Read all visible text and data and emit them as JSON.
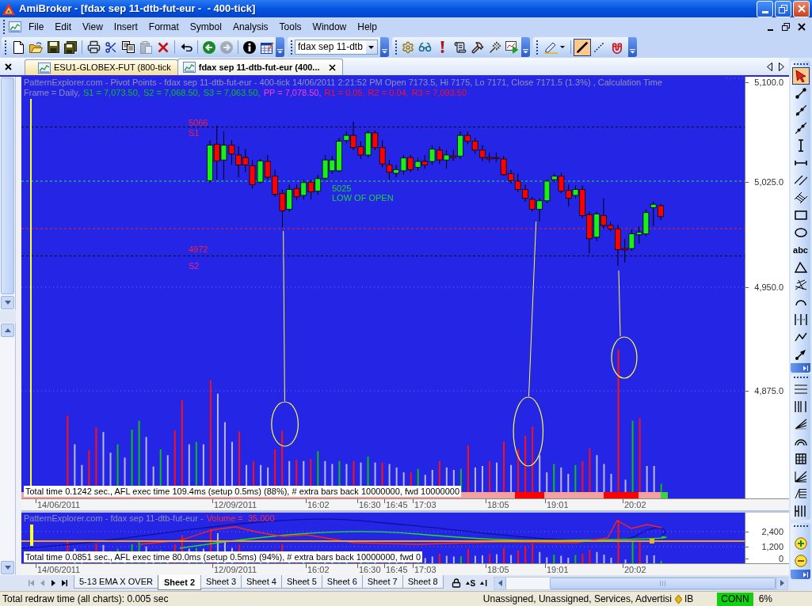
{
  "window": {
    "title": "AmiBroker - [fdax sep 11-dtb-fut-eur -  - 400-tick]"
  },
  "menu": [
    "File",
    "Edit",
    "View",
    "Insert",
    "Format",
    "Symbol",
    "Analysis",
    "Tools",
    "Window",
    "Help"
  ],
  "toolbar": {
    "standard": [
      {
        "kind": "new",
        "disabled": false
      },
      {
        "kind": "open",
        "disabled": false
      },
      {
        "kind": "save",
        "disabled": false
      },
      {
        "kind": "save_all",
        "disabled": false
      },
      {
        "kind": "print",
        "disabled": false
      },
      {
        "kind": "cut",
        "disabled": false
      },
      {
        "kind": "copy",
        "disabled": false
      },
      {
        "kind": "paste",
        "disabled": true
      },
      {
        "kind": "delete",
        "disabled": false
      },
      {
        "kind": "undo",
        "disabled": false
      },
      {
        "kind": "back",
        "disabled": false
      },
      {
        "kind": "forward",
        "disabled": true
      },
      {
        "kind": "info",
        "disabled": false
      },
      {
        "kind": "edit",
        "disabled": false
      }
    ],
    "symbol": {
      "value": "fdax sep 11-dtb"
    },
    "drawing": [
      {
        "kind": "pen",
        "selected": false
      },
      {
        "kind": "line",
        "selected": true
      },
      {
        "kind": "dotted",
        "selected": false
      },
      {
        "kind": "magnet",
        "selected": false
      }
    ]
  },
  "document_tabs": [
    {
      "label": "ESU1-GLOBEX-FUT (800-tick",
      "selected": false
    },
    {
      "label": "fdax sep 11-dtb-fut-eur (400...",
      "selected": true
    }
  ],
  "price_pane": {
    "title": "PatternExplorer.com - Pivot Points - fdax sep 11-dtb-fut-eur - 400-tick 14/06/2011 2:21:52 PM Open 7173.5, Hi 7175, Lo 7171, Close 7171.5 (1.3%) , Calculation Time",
    "pivots": [
      {
        "text": "Frame = Daily,",
        "color": "#9090b8"
      },
      {
        "text": "S1 = 7,073.50,",
        "color": "#10c020"
      },
      {
        "text": "S2 = 7,068.50,",
        "color": "#10c020"
      },
      {
        "text": "S3 = 7,063.50,",
        "color": "#10c020"
      },
      {
        "text": "PP = 7,078.50,",
        "color": "#ff40d0"
      },
      {
        "text": "R1 = 0.05,",
        "color": "#ff1020"
      },
      {
        "text": "R2 = 0.04,",
        "color": "#ff1020"
      },
      {
        "text": "R3 = 7,093.50",
        "color": "#ff1020"
      }
    ],
    "levels": [
      {
        "text": "5066",
        "color": "#ff2030"
      },
      {
        "text": "S1",
        "color": "#ff2030"
      },
      {
        "text": "5025",
        "color": "#20d040"
      },
      {
        "text": "LOW OF OPEN",
        "color": "#20d040"
      },
      {
        "text": "4972",
        "color": "#ff2030"
      },
      {
        "text": "S2",
        "color": "#f0209a"
      }
    ],
    "axis_labels": [
      "5,100.0",
      "5,025.0",
      "4,950.0",
      "4,875.0"
    ],
    "timing": "Total time 0.1242 sec., AFL exec time 109.4ms (setup 0.5ms) (88%), # extra bars back 10000000, fwd 10000000",
    "dates": [
      "14/06/2011",
      "12/09/2011",
      "16:02",
      "16:30",
      "16:45",
      "17:03",
      "18:05",
      "19:01",
      "20:02"
    ]
  },
  "volume_pane": {
    "title": [
      {
        "text": "PatternExplorer.com - fdax sep 11-dtb-fut-eur -",
        "color": "#9090b8"
      },
      {
        "text": "Volume =  35.000",
        "color": "#ff3030"
      }
    ],
    "axis_labels": [
      "2,400",
      "1,200",
      "0"
    ],
    "timing": "Total time 0.0851 sec., AFL exec time 80.0ms (setup 0.5ms) (94%), # extra bars back 10000000, fwd 0",
    "dates": [
      "14/06/2011",
      "12/09/2011",
      "16:02",
      "16:30",
      "16:45",
      "17:03",
      "18:05",
      "19:01",
      "20:02"
    ]
  },
  "drawing_tools": [
    {
      "kind": "pointer",
      "selected": true
    },
    {
      "kind": "segment",
      "selected": false
    },
    {
      "kind": "ray",
      "selected": false
    },
    {
      "kind": "extended",
      "selected": false
    },
    {
      "kind": "vertical",
      "selected": false
    },
    {
      "kind": "horizontal",
      "selected": false
    },
    {
      "kind": "parallel",
      "selected": false
    },
    {
      "kind": "channel",
      "selected": false
    },
    {
      "kind": "rectangle",
      "selected": false
    },
    {
      "kind": "ellipse",
      "selected": false
    },
    {
      "kind": "text",
      "label": "abc",
      "selected": false
    },
    {
      "kind": "triangle",
      "selected": false
    },
    {
      "kind": "crossed",
      "selected": false
    },
    {
      "kind": "arc",
      "selected": false
    },
    {
      "kind": "cycles",
      "selected": false
    },
    {
      "kind": "zigzag",
      "selected": false
    },
    {
      "kind": "arrow",
      "selected": false
    }
  ],
  "sheet_nav": [
    {
      "kind": "first",
      "disabled": true
    },
    {
      "kind": "previous",
      "disabled": true
    },
    {
      "kind": "next",
      "disabled": false
    },
    {
      "kind": "last",
      "disabled": false
    }
  ],
  "sheet_tabs": [
    {
      "label": "5-13 EMA X OVER",
      "selected": false
    },
    {
      "label": "Sheet 2",
      "selected": true
    },
    {
      "label": "Sheet 3",
      "selected": false
    },
    {
      "label": "Sheet 4",
      "selected": false
    },
    {
      "label": "Sheet 5",
      "selected": false
    },
    {
      "label": "Sheet 6",
      "selected": false
    },
    {
      "label": "Sheet 7",
      "selected": false
    },
    {
      "label": "Sheet 8",
      "selected": false
    }
  ],
  "sheet_buttons": [
    "S",
    "I"
  ],
  "status_bar": {
    "message": "Total redraw time (all charts): 0.005 sec",
    "workspace": "Unassigned, Unassigned, Services, Advertisi",
    "plugin": "IB",
    "connection": "CONN",
    "load": "6%"
  }
}
